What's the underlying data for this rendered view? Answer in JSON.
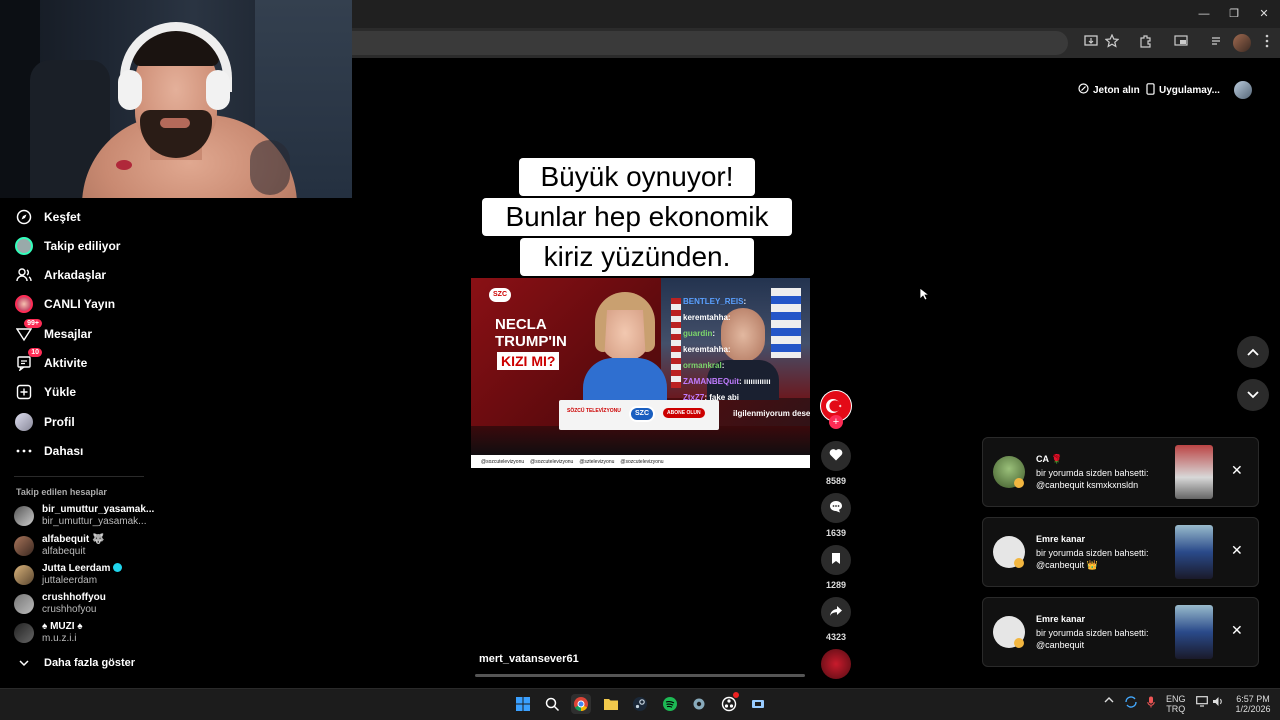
{
  "browser": {
    "window_controls": [
      "—",
      "❐",
      "✕"
    ]
  },
  "topbar": {
    "coins_label": "Jeton alın",
    "app_label": "Uygulamay..."
  },
  "sidebar": {
    "nav": [
      {
        "label": "Keşfet",
        "icon": "compass-icon"
      },
      {
        "label": "Takip ediliyor",
        "icon": "avatar-icon"
      },
      {
        "label": "Arkadaşlar",
        "icon": "friends-icon"
      },
      {
        "label": "CANLI Yayın",
        "icon": "live-icon"
      },
      {
        "label": "Mesajlar",
        "icon": "messages-icon",
        "badge": "99+"
      },
      {
        "label": "Aktivite",
        "icon": "activity-icon",
        "badge": "10"
      },
      {
        "label": "Yükle",
        "icon": "upload-icon"
      },
      {
        "label": "Profil",
        "icon": "profile-icon"
      },
      {
        "label": "Dahası",
        "icon": "more-icon"
      }
    ],
    "following_title": "Takip edilen hesaplar",
    "following": [
      {
        "name": "bir_umuttur_yasamak...",
        "handle": "bir_umuttur_yasamak..."
      },
      {
        "name": "alfabequit 🐺",
        "handle": "alfabequit"
      },
      {
        "name": "Jutta Leerdam",
        "handle": "juttaleerdam",
        "verified": true
      },
      {
        "name": "crushhoffyou",
        "handle": "crushhofyou"
      },
      {
        "name": "♠ MUZI ♠",
        "handle": "m.u.z.i.i"
      }
    ],
    "show_more": "Daha fazla göster"
  },
  "video": {
    "caption_lines": [
      "Büyük oynuyor!",
      "Bunlar hep ekonomik",
      "kiriz yüzünden."
    ],
    "author": "mert_vatansever61",
    "overlay": {
      "channel_logo": "SZC",
      "headline_lines": [
        "NECLA",
        "TRUMP'IN"
      ],
      "headline_highlight": "KIZI MI?",
      "lower_bar": "SÖZCÜ TELEVİZYONU",
      "subscribe": "ABONE OLUN",
      "socials": [
        "@sozcutelevizyonu",
        "@sozcutelevizyonu",
        "@sztelevizyonu",
        "@sozcutelevizyonu"
      ]
    },
    "chat": [
      {
        "user": "BENTLEY_REIS",
        "text": ":",
        "color": "#5aa0ff"
      },
      {
        "user": "keremtahha",
        "text": ":",
        "color": "#ffffff"
      },
      {
        "user": "guardin",
        "text": ":",
        "color": "#7cd66b"
      },
      {
        "user": "keremtahha",
        "text": ":",
        "color": "#ffffff"
      },
      {
        "user": "ormankral",
        "text": ":",
        "color": "#7cd66b"
      },
      {
        "user": "ZAMANBEQuit",
        "text": ": ıııııııııııı",
        "color": "#c07cff"
      },
      {
        "user": "ZtxZ7",
        "text": ": fake abi",
        "color": "#c07cff"
      },
      {
        "user": "",
        "text": "ilgilenmiyorum desen çıkmayacak",
        "color": "#ffffff"
      }
    ]
  },
  "actions": {
    "likes": "8589",
    "comments": "1639",
    "saves": "1289",
    "shares": "4323"
  },
  "notifications": [
    {
      "name": "CA 🌹",
      "text": "bir yorumda sizden bahsetti: @canbequit ksmxkxnsldn"
    },
    {
      "name": "Emre kanar",
      "text": "bir yorumda sizden bahsetti: @canbequit 👑"
    },
    {
      "name": "Emre kanar",
      "text": "bir yorumda sizden bahsetti: @canbequit"
    }
  ],
  "taskbar": {
    "lang_top": "ENG",
    "lang_bottom": "TRQ",
    "time": "6:57 PM",
    "date": "1/2/2026"
  },
  "colors": {
    "accent": "#fe2c55",
    "notif_bg": "#111111",
    "video_red": "#7a0f12"
  }
}
